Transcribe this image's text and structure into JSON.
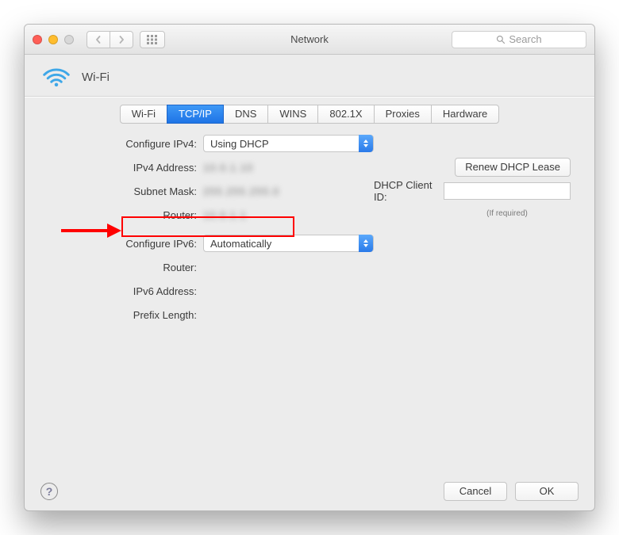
{
  "window": {
    "title": "Network",
    "search_placeholder": "Search"
  },
  "header": {
    "title": "Wi-Fi"
  },
  "tabs": {
    "items": [
      "Wi-Fi",
      "TCP/IP",
      "DNS",
      "WINS",
      "802.1X",
      "Proxies",
      "Hardware"
    ],
    "active_index": 1
  },
  "form": {
    "configure_ipv4_label": "Configure IPv4:",
    "configure_ipv4_value": "Using DHCP",
    "ipv4_address_label": "IPv4 Address:",
    "ipv4_address_value": "10.0.1.10",
    "subnet_mask_label": "Subnet Mask:",
    "subnet_mask_value": "255.255.255.0",
    "router_label": "Router:",
    "router_value": "10.0.1.1",
    "renew_button": "Renew DHCP Lease",
    "dhcp_client_id_label": "DHCP Client ID:",
    "dhcp_client_id_value": "",
    "if_required": "(If required)",
    "configure_ipv6_label": "Configure IPv6:",
    "configure_ipv6_value": "Automatically",
    "router6_label": "Router:",
    "ipv6_address_label": "IPv6 Address:",
    "prefix_length_label": "Prefix Length:"
  },
  "footer": {
    "cancel": "Cancel",
    "ok": "OK"
  }
}
